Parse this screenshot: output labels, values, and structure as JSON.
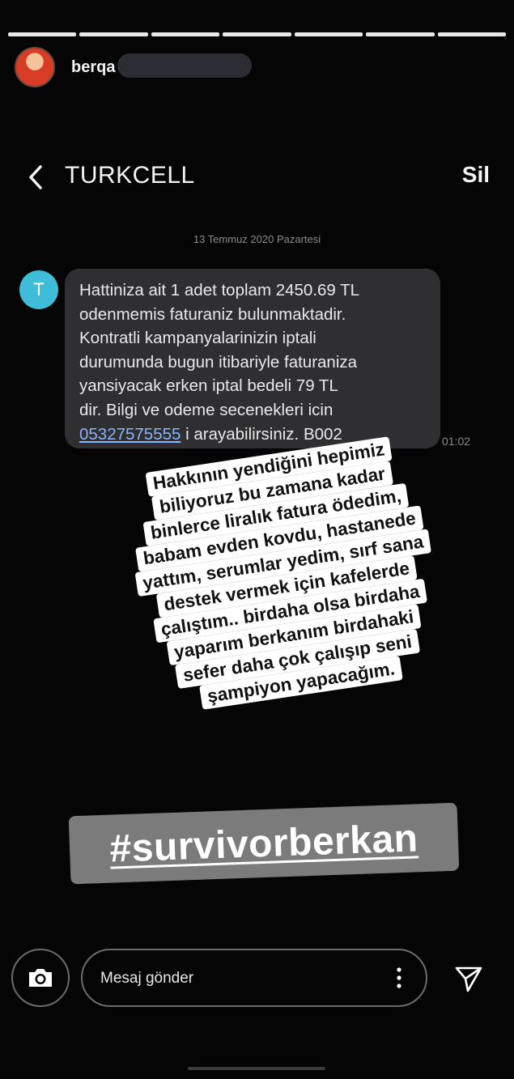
{
  "story": {
    "segments": 7,
    "username": "berqa"
  },
  "sms": {
    "title": "TURKCELL",
    "delete_label": "Sil",
    "date": "13 Temmuz 2020 Pazartesi",
    "sender_initial": "T",
    "message_lines": [
      "Hattiniza ait 1 adet toplam 2450.69 TL",
      "odenmemis faturaniz bulunmaktadir.",
      "Kontratli kampanyalarinizin iptali",
      "durumunda bugun itibariyle faturaniza",
      "yansiyacak erken iptal bedeli 79 TL",
      "dir. Bilgi ve odeme secenekleri icin"
    ],
    "phone_link": "05327575555",
    "last_line_rest": " i arayabilirsiniz. B002",
    "time": "01:02"
  },
  "sticker": {
    "lines": [
      "Hakkının yendiğini hepimiz",
      "biliyoruz bu zamana kadar",
      "binlerce liralık fatura ödedim,",
      "babam evden kovdu, hastanede",
      "yattım, serumlar yedim, sırf sana",
      "destek vermek için kafelerde",
      "çalıştım.. birdaha olsa birdaha",
      "yaparım berkanım birdahaki",
      "sefer daha çok çalışıp seni",
      "şampiyon yapacağım."
    ]
  },
  "hashtag": "#survivorberkan",
  "reply": {
    "placeholder": "Mesaj gönder"
  },
  "colors": {
    "background": "#050505",
    "bubble": "#2f2f31",
    "sender_avatar": "#3fbcd7",
    "link": "#8ab4f8",
    "hashtag_bg": "#7b7b7b"
  },
  "icons": [
    "chevron-left-icon",
    "camera-icon",
    "more-vertical-icon",
    "send-icon"
  ]
}
